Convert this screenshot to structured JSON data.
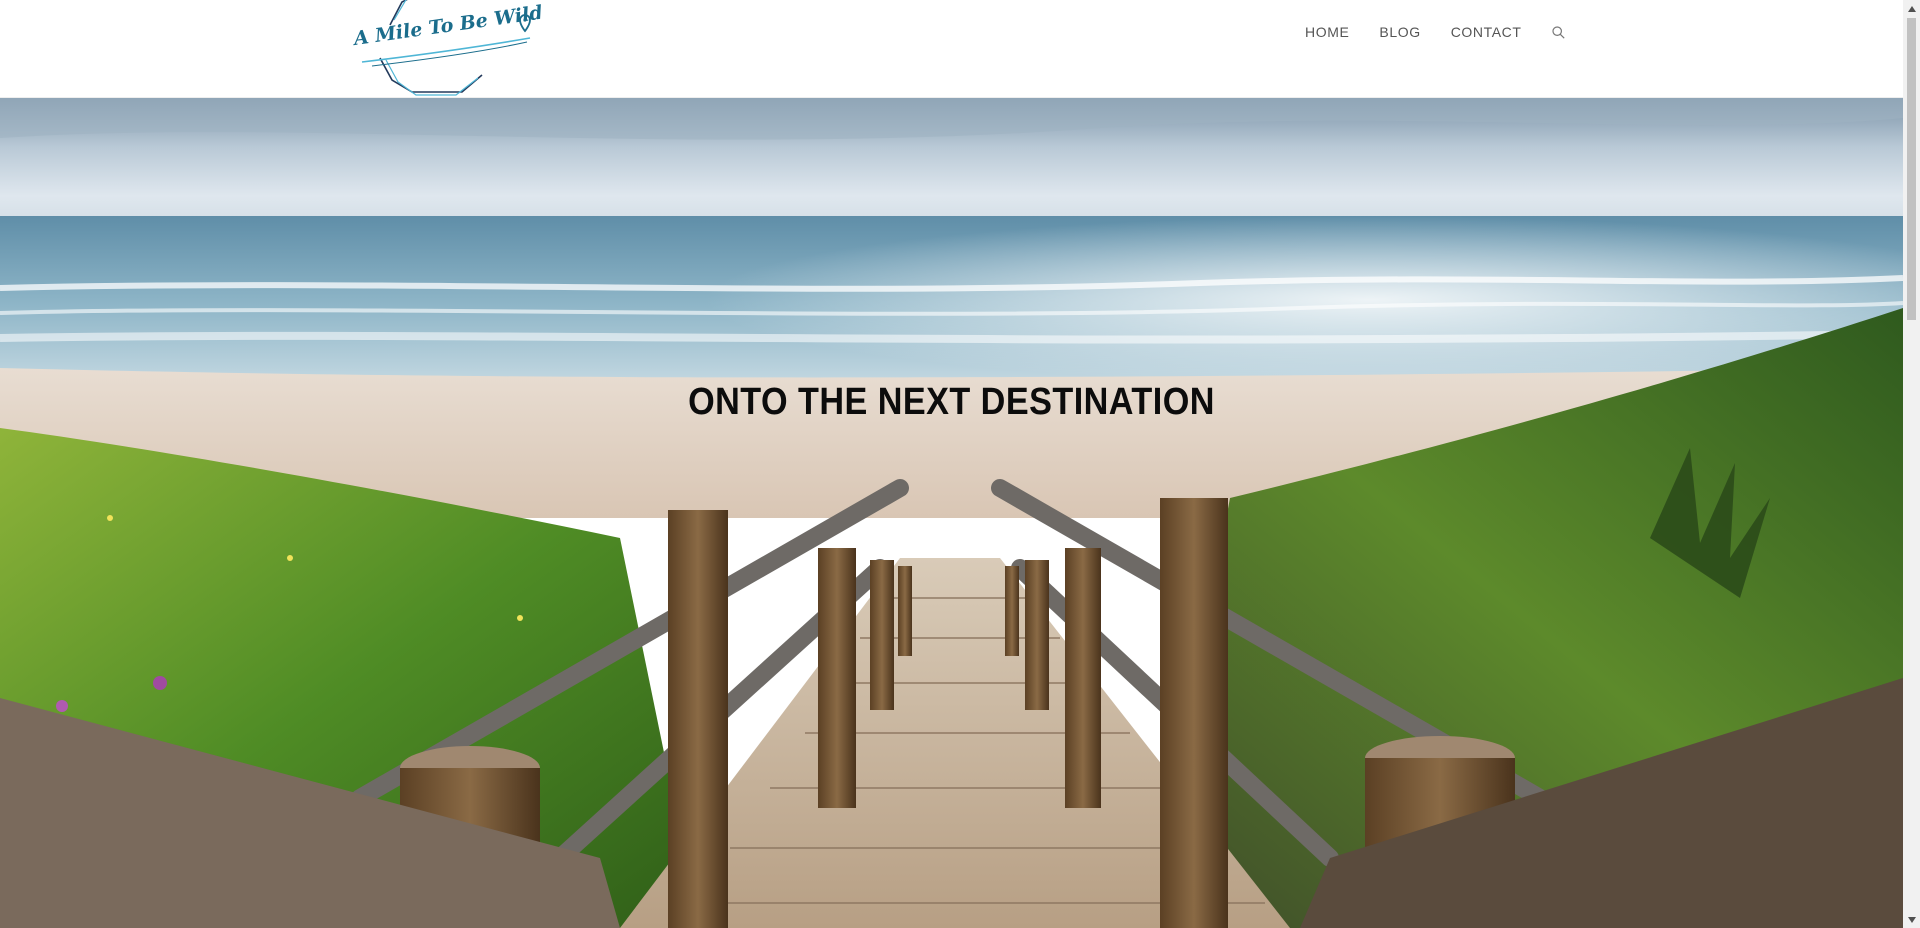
{
  "site": {
    "logo_text": "A Mile To Be Wild",
    "logo_icon": "map-pin-icon",
    "brand_colors": {
      "teal": "#1b6d8c",
      "light_blue": "#4fb6d6",
      "navy": "#233a5c"
    }
  },
  "nav": {
    "items": [
      {
        "label": "HOME"
      },
      {
        "label": "BLOG"
      },
      {
        "label": "CONTACT"
      }
    ],
    "search_icon": "search-icon",
    "text_color": "#555555"
  },
  "hero": {
    "title": "ONTO THE NEXT DESTINATION",
    "title_color": "#0c0c0c"
  }
}
